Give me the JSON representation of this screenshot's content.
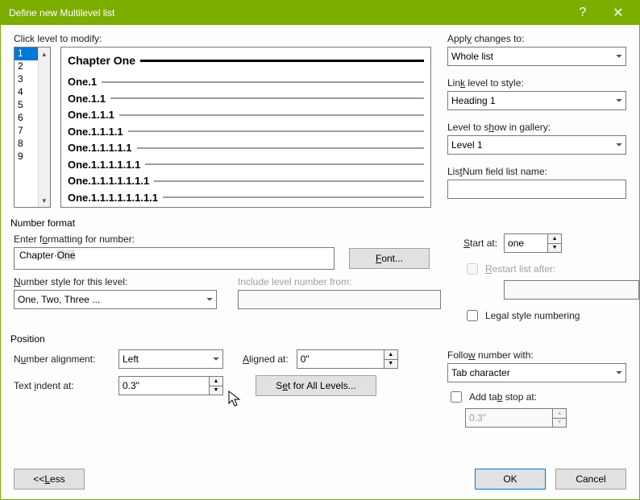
{
  "window": {
    "title": "Define new Multilevel list",
    "help": "?",
    "close": "✕"
  },
  "levels": {
    "label": "Click level to modify:",
    "items": [
      "1",
      "2",
      "3",
      "4",
      "5",
      "6",
      "7",
      "8",
      "9"
    ],
    "selected": "1"
  },
  "preview": {
    "lines": [
      "Chapter One",
      "One.1",
      "One.1.1",
      "One.1.1.1",
      "One.1.1.1.1",
      "One.1.1.1.1.1",
      "One.1.1.1.1.1.1",
      "One.1.1.1.1.1.1.1",
      "One.1.1.1.1.1.1.1.1"
    ]
  },
  "right": {
    "apply_label_pre": "Appl",
    "apply_label_u": "y",
    "apply_label_post": " changes to:",
    "apply_value": "Whole list",
    "link_label_pre": "Lin",
    "link_label_u": "k",
    "link_label_post": " level to style:",
    "link_value": "Heading 1",
    "show_label_pre": "Level to s",
    "show_label_u": "h",
    "show_label_post": "ow in gallery:",
    "show_value": "Level 1",
    "listnum_label_pre": "Lis",
    "listnum_label_u": "t",
    "listnum_label_post": "Num field list name:",
    "listnum_value": ""
  },
  "number_format": {
    "section_title": "Number format",
    "enter_label_pre": "Enter f",
    "enter_label_u": "o",
    "enter_label_post": "rmatting for number:",
    "value_prefix": "Chapter·",
    "value_num": "One",
    "font_label_u": "F",
    "font_label_post": "ont...",
    "style_label_u": "N",
    "style_label_post": "umber style for this level:",
    "style_value": "One, Two, Three ...",
    "include_label": "Include level number from:",
    "include_value": "",
    "start_label_u": "S",
    "start_label_post": "tart at:",
    "start_value": "one",
    "restart_label_u": "R",
    "restart_label_post": "estart list after:",
    "restart_value": "",
    "legal_label_pre": "Le",
    "legal_label_u": "g",
    "legal_label_post": "al style numbering"
  },
  "position": {
    "section_title": "Position",
    "align_label_pre": "N",
    "align_label_u": "u",
    "align_label_post": "mber alignment:",
    "align_value": "Left",
    "aligned_at_label_u": "A",
    "aligned_at_label_post": "ligned at:",
    "aligned_at_value": "0\"",
    "indent_label_pre": "Text ",
    "indent_label_u": "i",
    "indent_label_post": "ndent at:",
    "indent_value": "0.3\"",
    "set_all_label_pre": "S",
    "set_all_label_u": "e",
    "set_all_label_post": "t for All Levels...",
    "follow_label_pre": "Follo",
    "follow_label_u": "w",
    "follow_label_post": " number with:",
    "follow_value": "Tab character",
    "addtab_label_pre": "Add ta",
    "addtab_label_u": "b",
    "addtab_label_post": " stop at:",
    "addtab_value": "0.3\""
  },
  "footer": {
    "less_pre": "<< ",
    "less_u": "L",
    "less_post": "ess",
    "ok": "OK",
    "cancel": "Cancel"
  }
}
